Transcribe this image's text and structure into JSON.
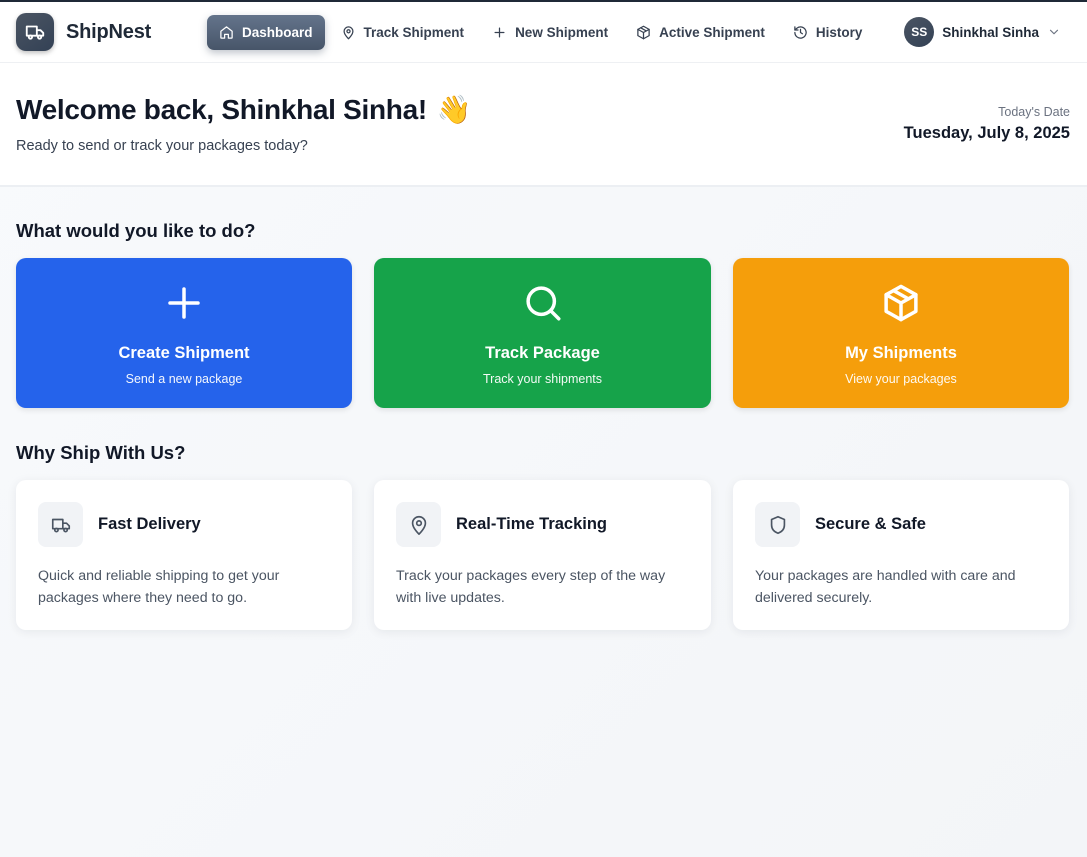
{
  "app": {
    "name": "ShipNest"
  },
  "nav": {
    "items": [
      {
        "label": "Dashboard",
        "active": true
      },
      {
        "label": "Track Shipment",
        "active": false
      },
      {
        "label": "New Shipment",
        "active": false
      },
      {
        "label": "Active Shipment",
        "active": false
      },
      {
        "label": "History",
        "active": false
      }
    ]
  },
  "user": {
    "initials": "SS",
    "name": "Shinkhal Sinha"
  },
  "welcome": {
    "title": "Welcome back, Shinkhal Sinha!",
    "emoji": "👋",
    "subtitle": "Ready to send or track your packages today?",
    "date_label": "Today's Date",
    "date_value": "Tuesday, July 8, 2025"
  },
  "actions": {
    "heading": "What would you like to do?",
    "cards": [
      {
        "title": "Create Shipment",
        "subtitle": "Send a new package",
        "color": "#2563eb",
        "icon": "plus-icon"
      },
      {
        "title": "Track Package",
        "subtitle": "Track your shipments",
        "color": "#16a34a",
        "icon": "search-icon"
      },
      {
        "title": "My Shipments",
        "subtitle": "View your packages",
        "color": "#f59e0b",
        "icon": "package-icon"
      }
    ]
  },
  "features": {
    "heading": "Why Ship With Us?",
    "cards": [
      {
        "title": "Fast Delivery",
        "description": "Quick and reliable shipping to get your packages where they need to go.",
        "icon": "truck-icon"
      },
      {
        "title": "Real-Time Tracking",
        "description": "Track your packages every step of the way with live updates.",
        "icon": "map-pin-icon"
      },
      {
        "title": "Secure & Safe",
        "description": "Your packages are handled with care and delivered securely.",
        "icon": "shield-icon"
      }
    ]
  }
}
